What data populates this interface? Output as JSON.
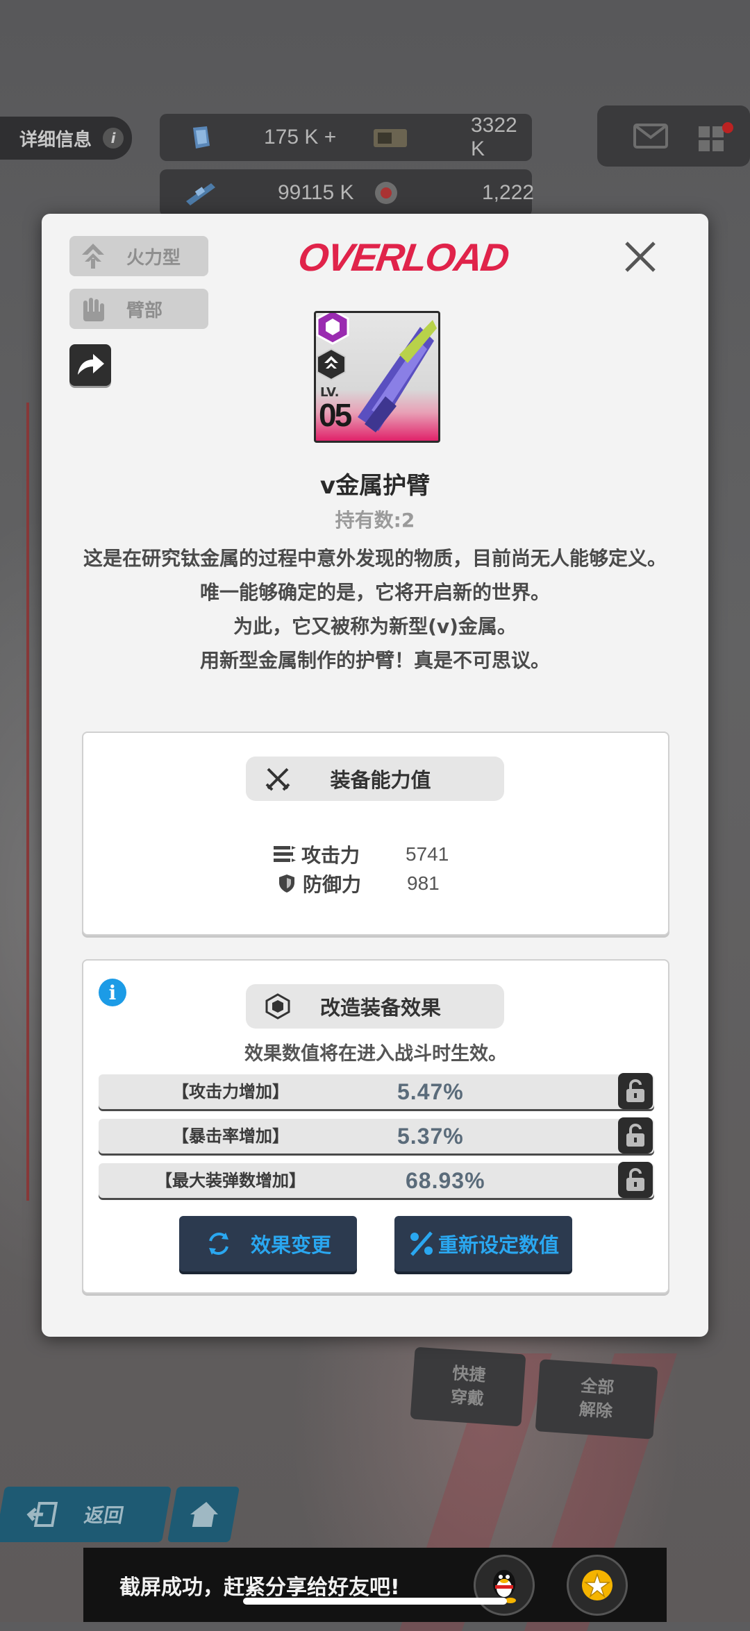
{
  "hud": {
    "info_label": "详细信息",
    "info_icon": "i",
    "res1_value": "175 K +",
    "res2_value": "3322 K",
    "res3_value": "99115 K",
    "res4_value": "1,222"
  },
  "side": {
    "quick_equip": [
      "快捷",
      "穿戴"
    ],
    "unequip_all": [
      "全部",
      "解除"
    ],
    "back_label": "返回"
  },
  "dialog": {
    "tag_type": "火力型",
    "tag_slot": "臂部",
    "brand": "OVERLOAD",
    "item": {
      "level_prefix": "LV.",
      "level": "05",
      "name": "v金属护臂",
      "owned": "持有数:2"
    },
    "description": [
      "这是在研究钛金属的过程中意外发现的物质，目前尚无人能够定义。",
      "唯一能够确定的是，它将开启新的世界。",
      "为此，它又被称为新型(v)金属。",
      "用新型金属制作的护臂！真是不可思议。"
    ],
    "stats_panel": {
      "title": "装备能力值",
      "stats": [
        {
          "label": "攻击力",
          "value": "5741",
          "icon": "attack-icon"
        },
        {
          "label": "防御力",
          "value": "981",
          "icon": "shield-icon"
        }
      ]
    },
    "mod_panel": {
      "title": "改造装备效果",
      "note": "效果数值将在进入战斗时生效。",
      "effects": [
        {
          "name": "【攻击力增加】",
          "value": "5.47%"
        },
        {
          "name": "【暴击率增加】",
          "value": "5.37%"
        },
        {
          "name": "【最大装弹数增加】",
          "value": "68.93%"
        }
      ],
      "change_button": "效果变更",
      "reset_button": "重新设定数值"
    }
  },
  "toast": {
    "message": "截屏成功，赶紧分享给好友吧!"
  },
  "colors": {
    "accent_blue": "#2aa7f0",
    "brand_red": "#e0234a",
    "info_blue": "#1c9be6"
  }
}
